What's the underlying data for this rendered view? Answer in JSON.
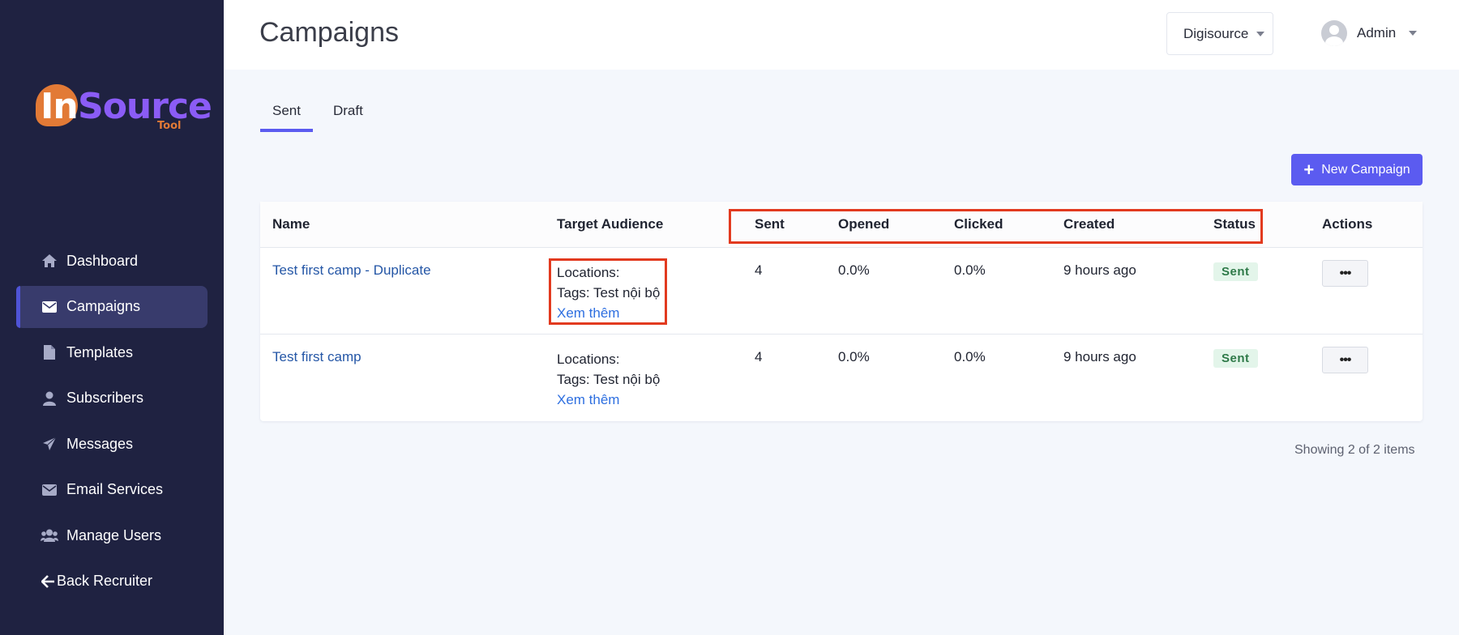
{
  "logo": {
    "in": "In",
    "source": "Source",
    "tool": "Tool"
  },
  "sidebar": {
    "items": [
      {
        "label": "Dashboard",
        "icon": "home-icon"
      },
      {
        "label": "Campaigns",
        "icon": "envelope-icon",
        "active": true
      },
      {
        "label": "Templates",
        "icon": "file-icon"
      },
      {
        "label": "Subscribers",
        "icon": "user-icon"
      },
      {
        "label": "Messages",
        "icon": "paper-plane-icon"
      },
      {
        "label": "Email Services",
        "icon": "envelope-icon"
      },
      {
        "label": "Manage Users",
        "icon": "users-icon"
      },
      {
        "label": "Back Recruiter",
        "icon": "arrow-left-icon"
      }
    ]
  },
  "header": {
    "title": "Campaigns",
    "workspace": "Digisource",
    "user": "Admin"
  },
  "tabs": [
    {
      "label": "Sent",
      "active": true
    },
    {
      "label": "Draft",
      "active": false
    }
  ],
  "new_campaign_label": "New Campaign",
  "table": {
    "columns": [
      "Name",
      "Target Audience",
      "Sent",
      "Opened",
      "Clicked",
      "Created",
      "Status",
      "Actions"
    ],
    "rows": [
      {
        "name": "Test first camp - Duplicate",
        "locations": "Locations:",
        "tags": "Tags: Test nội bộ",
        "more": "Xem thêm",
        "sent": "4",
        "opened": "0.0%",
        "clicked": "0.0%",
        "created": "9 hours ago",
        "status": "Sent",
        "actions": "•••"
      },
      {
        "name": "Test first camp",
        "locations": "Locations:",
        "tags": "Tags: Test nội bộ",
        "more": "Xem thêm",
        "sent": "4",
        "opened": "0.0%",
        "clicked": "0.0%",
        "created": "9 hours ago",
        "status": "Sent",
        "actions": "•••"
      }
    ]
  },
  "pagination": {
    "showing": "Showing 2 of 2 items"
  },
  "colors": {
    "sidebar": "#1f2241",
    "accent": "#5b5bf0",
    "highlight": "#e23a1f",
    "status_sent_bg": "#e3f5ea"
  }
}
